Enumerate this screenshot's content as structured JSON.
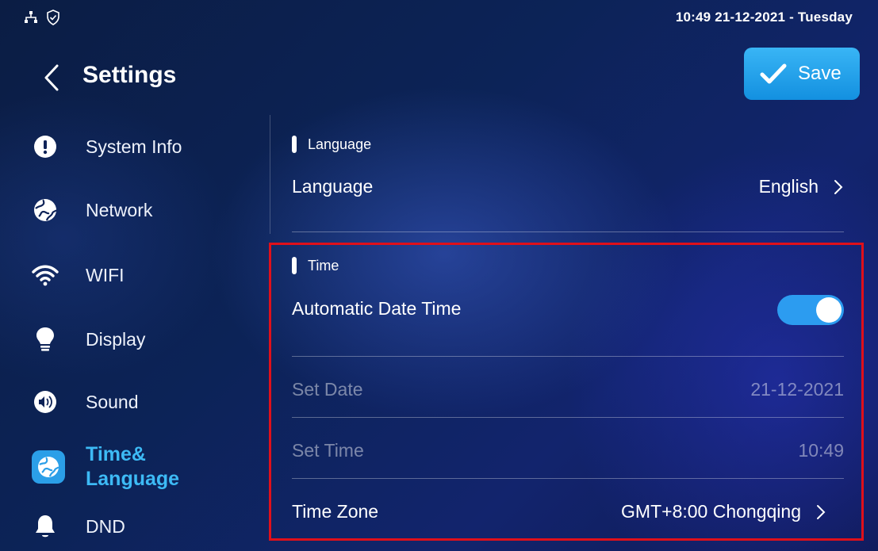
{
  "status_bar": {
    "datetime": "10:49  21-12-2021 - Tuesday",
    "icons": [
      "network-tree-icon",
      "shield-check-icon"
    ]
  },
  "header": {
    "title": "Settings",
    "save_label": "Save",
    "accent": "#2ba4ee"
  },
  "sidebar": {
    "items": [
      {
        "label": "System Info",
        "icon": "info-icon",
        "active": false
      },
      {
        "label": "Network",
        "icon": "network-globe-icon",
        "active": false
      },
      {
        "label": "WIFI",
        "icon": "wifi-icon",
        "active": false
      },
      {
        "label": "Display",
        "icon": "lightbulb-icon",
        "active": false
      },
      {
        "label": "Sound",
        "icon": "speaker-icon",
        "active": false
      },
      {
        "label": "Time&",
        "label_line2": "Language",
        "icon": "globe-icon",
        "active": true
      },
      {
        "label": "DND",
        "icon": "bell-icon",
        "active": false
      }
    ],
    "active_color": "#3dbaf5"
  },
  "main": {
    "language_section": {
      "title": "Language",
      "rows": [
        {
          "label": "Language",
          "value": "English"
        }
      ]
    },
    "time_section": {
      "title": "Time",
      "automatic_date_time": {
        "label": "Automatic Date Time",
        "enabled": true
      },
      "set_date": {
        "label": "Set Date",
        "value": "21-12-2021"
      },
      "set_time": {
        "label": "Set Time",
        "value": "10:49"
      },
      "time_zone": {
        "label": "Time Zone",
        "value": "GMT+8:00 Chongqing"
      }
    }
  },
  "annotation": {
    "highlight_color": "#e0101a"
  }
}
